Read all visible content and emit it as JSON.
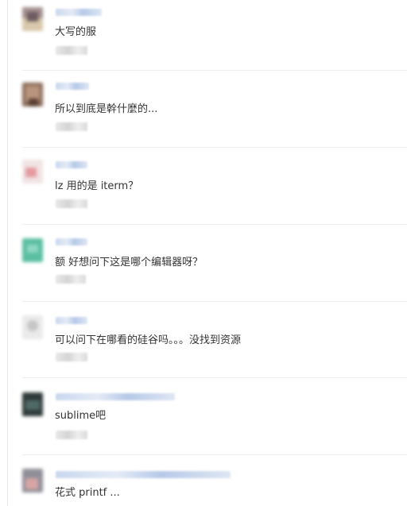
{
  "comments": [
    {
      "text": "大写的服"
    },
    {
      "text": "所以到底是幹什麼的..."
    },
    {
      "text": "lz 用的是 iterm？"
    },
    {
      "text": "额 好想问下这是哪个编辑器呀？"
    },
    {
      "text": "可以问下在哪看的硅谷吗。。。没找到资源"
    },
    {
      "text": "sublime吧"
    },
    {
      "text": "花式 printf ..."
    }
  ],
  "colors": {
    "text": "#333333",
    "separator": "#efefef",
    "username": "#c3d3ee",
    "timestamp": "#dddddd"
  }
}
